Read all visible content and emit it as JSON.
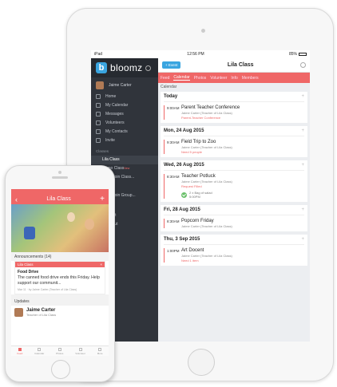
{
  "ipad": {
    "status": {
      "carrier": "iPad",
      "time": "12:56 PM",
      "battery": "85%"
    },
    "sidebar": {
      "brand": "bloomz",
      "user": "Jaime Carter",
      "items": [
        {
          "label": "Home",
          "icon": "home-icon"
        },
        {
          "label": "My Calendar",
          "icon": "calendar-icon"
        },
        {
          "label": "Messages",
          "icon": "message-icon"
        },
        {
          "label": "Volunteers",
          "icon": "volunteer-icon"
        },
        {
          "label": "My Contacts",
          "icon": "contacts-icon"
        },
        {
          "label": "Invite",
          "icon": "invite-icon"
        }
      ],
      "classes_section": "Classes",
      "classes": [
        {
          "label": "Lila Class"
        },
        {
          "label": "Demo Class",
          "badge": "New"
        },
        {
          "label": "Add / Join Class..."
        }
      ],
      "groups": [
        {
          "label": "Add / Join Group..."
        }
      ],
      "footer": [
        {
          "label": "Support"
        },
        {
          "label": "Sign Out"
        }
      ]
    },
    "topbar": {
      "event_button": "+ Event",
      "title": "Lila Class"
    },
    "tabs": [
      "Feed",
      "Calendar",
      "Photos",
      "Volunteer",
      "Info",
      "Members"
    ],
    "active_tab": "Calendar",
    "calendar_heading": "Calendar",
    "days": [
      {
        "date": "Today",
        "events": [
          {
            "time": "9:00AM",
            "title": "Parent Teacher Conference",
            "sub": "Jaime Carter (Teacher of Lila Class)",
            "note": "Parent-Teacher Conference"
          }
        ]
      },
      {
        "date": "Mon, 24 Aug 2015",
        "events": [
          {
            "time": "9:30AM",
            "title": "Field Trip to Zoo",
            "sub": "Jaime Carter (Teacher of Lila Class)",
            "note": "Need 5 people"
          }
        ]
      },
      {
        "date": "Wed, 26 Aug 2015",
        "events": [
          {
            "time": "8:30AM",
            "title": "Teacher Potluck",
            "sub": "Jaime Carter (Teacher of Lila Class)",
            "note": "Request Filled",
            "check": "2 x Bag of salad",
            "check_time": "5:00PM"
          }
        ]
      },
      {
        "date": "Fri, 28 Aug 2015",
        "events": [
          {
            "time": "8:30AM",
            "title": "Popcorn Friday",
            "sub": "Jaime Carter (Teacher of Lila Class)"
          }
        ]
      },
      {
        "date": "Thu, 3 Sep 2015",
        "events": [
          {
            "time": "1:00PM",
            "title": "Art Docent",
            "sub": "Jaime Carter (Teacher of Lila Class)",
            "note": "Need 1 item"
          }
        ]
      }
    ]
  },
  "iphone": {
    "title": "Lila Class",
    "announcements_label": "Announcements (14)",
    "announcement": {
      "class": "Lila Class",
      "title": "Food Drive",
      "text": "The canned food drive ends this Friday. Help support our communit...",
      "meta": "Mar 11 · by Jaime Carter (Teacher of Lila Class)"
    },
    "updates_label": "Updates",
    "update": {
      "name": "Jaime Carter",
      "role": "Teacher of Lila Class"
    },
    "tabbar": [
      {
        "label": "Feed",
        "icon": "feed-icon"
      },
      {
        "label": "Calendar",
        "icon": "calendar-icon"
      },
      {
        "label": "Photos",
        "icon": "photos-icon"
      },
      {
        "label": "Volunteer",
        "icon": "volunteer-icon"
      },
      {
        "label": "More",
        "icon": "more-icon"
      }
    ]
  },
  "colors": {
    "accent": "#ef6767",
    "brand_blue": "#3aa5e0",
    "sidebar_bg": "#30343b"
  }
}
